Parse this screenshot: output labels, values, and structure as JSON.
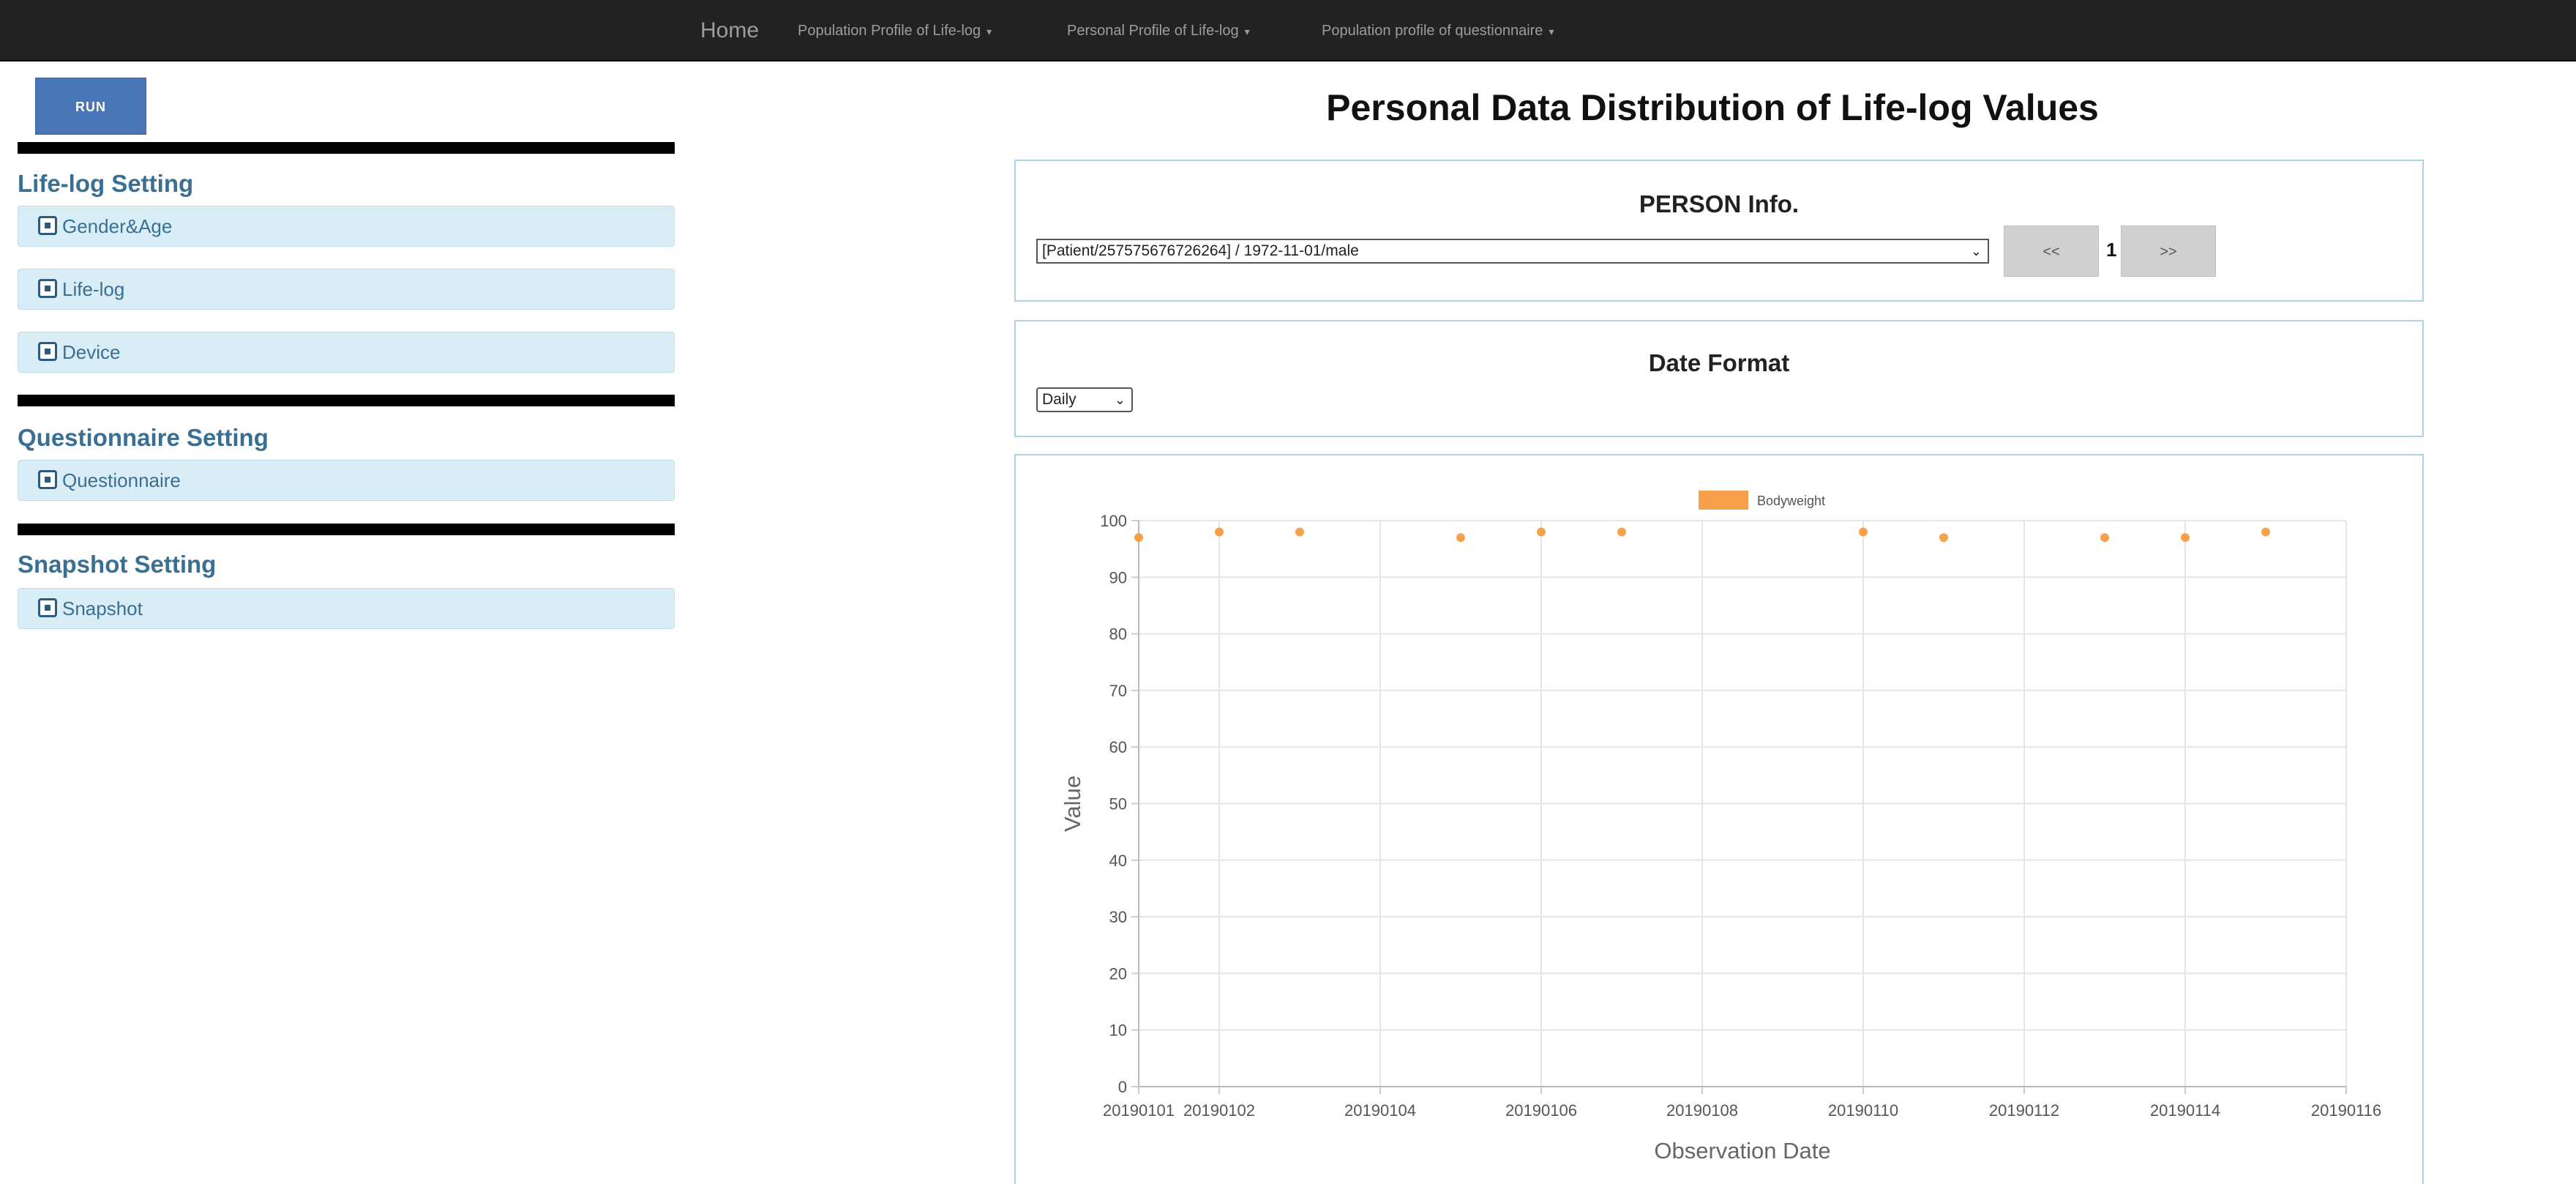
{
  "nav": {
    "home": "Home",
    "items": [
      "Population Profile of Life-log",
      "Personal Profile of Life-log",
      "Population profile of questionnaire"
    ]
  },
  "sidebar": {
    "run_label": "RUN",
    "sections": [
      {
        "title": "Life-log Setting",
        "items": [
          "Gender&Age",
          "Life-log",
          "Device"
        ]
      },
      {
        "title": "Questionnaire Setting",
        "items": [
          "Questionnaire"
        ]
      },
      {
        "title": "Snapshot Setting",
        "items": [
          "Snapshot"
        ]
      }
    ]
  },
  "main": {
    "title": "Personal Data Distribution of Life-log Values",
    "person_panel": {
      "heading": "PERSON Info.",
      "selected": "[Patient/257575676726264] / 1972-11-01/male",
      "prev_label": "<<",
      "next_label": ">>",
      "page": "1"
    },
    "date_panel": {
      "heading": "Date Format",
      "selected": "Daily"
    }
  },
  "colors": {
    "series": "#f7a04a",
    "navbar": "#222222",
    "panel_border": "#aad4e6",
    "accordion_bg": "#d9edf7",
    "run_button": "#4a76b8"
  },
  "chart_data": {
    "type": "scatter",
    "xlabel": "Observation Date",
    "ylabel": "Value",
    "ylim": [
      0,
      100
    ],
    "yticks": [
      0,
      10,
      20,
      30,
      40,
      50,
      60,
      70,
      80,
      90,
      100
    ],
    "xlim": [
      20190101,
      20190116
    ],
    "xticks": [
      "20190101",
      "20190102",
      "20190104",
      "20190106",
      "20190108",
      "20190110",
      "20190112",
      "20190114",
      "20190116"
    ],
    "grid": true,
    "legend": "top-center",
    "series": [
      {
        "name": "Bodyweight",
        "color": "#f7a04a",
        "points": [
          {
            "x": 20190101,
            "y": 97
          },
          {
            "x": 20190102,
            "y": 98
          },
          {
            "x": 20190103,
            "y": 98
          },
          {
            "x": 20190105,
            "y": 97
          },
          {
            "x": 20190106,
            "y": 98
          },
          {
            "x": 20190107,
            "y": 98
          },
          {
            "x": 20190110,
            "y": 98
          },
          {
            "x": 20190111,
            "y": 97
          },
          {
            "x": 20190113,
            "y": 97
          },
          {
            "x": 20190114,
            "y": 97
          },
          {
            "x": 20190115,
            "y": 98
          }
        ]
      }
    ]
  }
}
